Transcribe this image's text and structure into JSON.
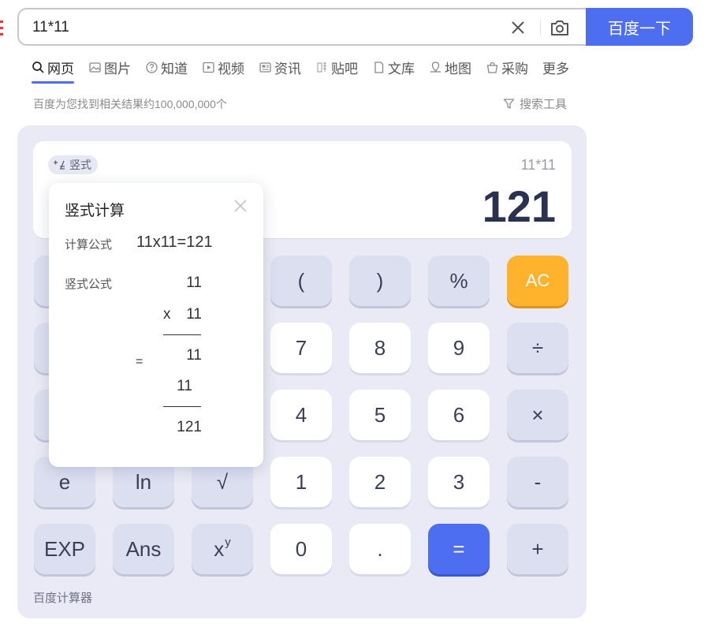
{
  "search": {
    "query": "11*11",
    "button_label": "百度一下"
  },
  "tabs": [
    {
      "label": "网页",
      "icon": "search-icon"
    },
    {
      "label": "图片",
      "icon": "image-icon"
    },
    {
      "label": "知道",
      "icon": "question-icon"
    },
    {
      "label": "视频",
      "icon": "play-icon"
    },
    {
      "label": "资讯",
      "icon": "news-icon"
    },
    {
      "label": "贴吧",
      "icon": "tieba-icon"
    },
    {
      "label": "文库",
      "icon": "doc-icon"
    },
    {
      "label": "地图",
      "icon": "map-icon"
    },
    {
      "label": "采购",
      "icon": "basket-icon"
    },
    {
      "label": "更多",
      "icon": ""
    }
  ],
  "result_count": "百度为您找到相关结果约100,000,000个",
  "search_tools_label": "搜索工具",
  "calculator": {
    "vertical_badge": "竖式",
    "expression": "11*11",
    "result": "121",
    "brand": "百度计算器",
    "keys": {
      "lparen": "(",
      "rparen": ")",
      "percent": "%",
      "ac": "AC",
      "n7": "7",
      "n8": "8",
      "n9": "9",
      "divide": "÷",
      "n4": "4",
      "n5": "5",
      "n6": "6",
      "multiply": "×",
      "e": "e",
      "ln": "ln",
      "sqrt": "√",
      "n1": "1",
      "n2": "2",
      "n3": "3",
      "minus": "-",
      "exp": "EXP",
      "ans": "Ans",
      "xy_base": "x",
      "xy_exp": "y",
      "n0": "0",
      "dot": ".",
      "equals": "=",
      "plus": "+"
    }
  },
  "popup": {
    "title": "竖式计算",
    "formula_label": "计算公式",
    "formula": "11x11=121",
    "vertical_label": "竖式公式",
    "vertical": {
      "top": "11",
      "op": "x",
      "second": "11",
      "eq": "=",
      "partial1": "11",
      "partial2": "11",
      "total": "121"
    }
  },
  "colors": {
    "accent": "#4e6ef2",
    "ac": "#ffb22c",
    "panel": "#e9eaf5"
  }
}
